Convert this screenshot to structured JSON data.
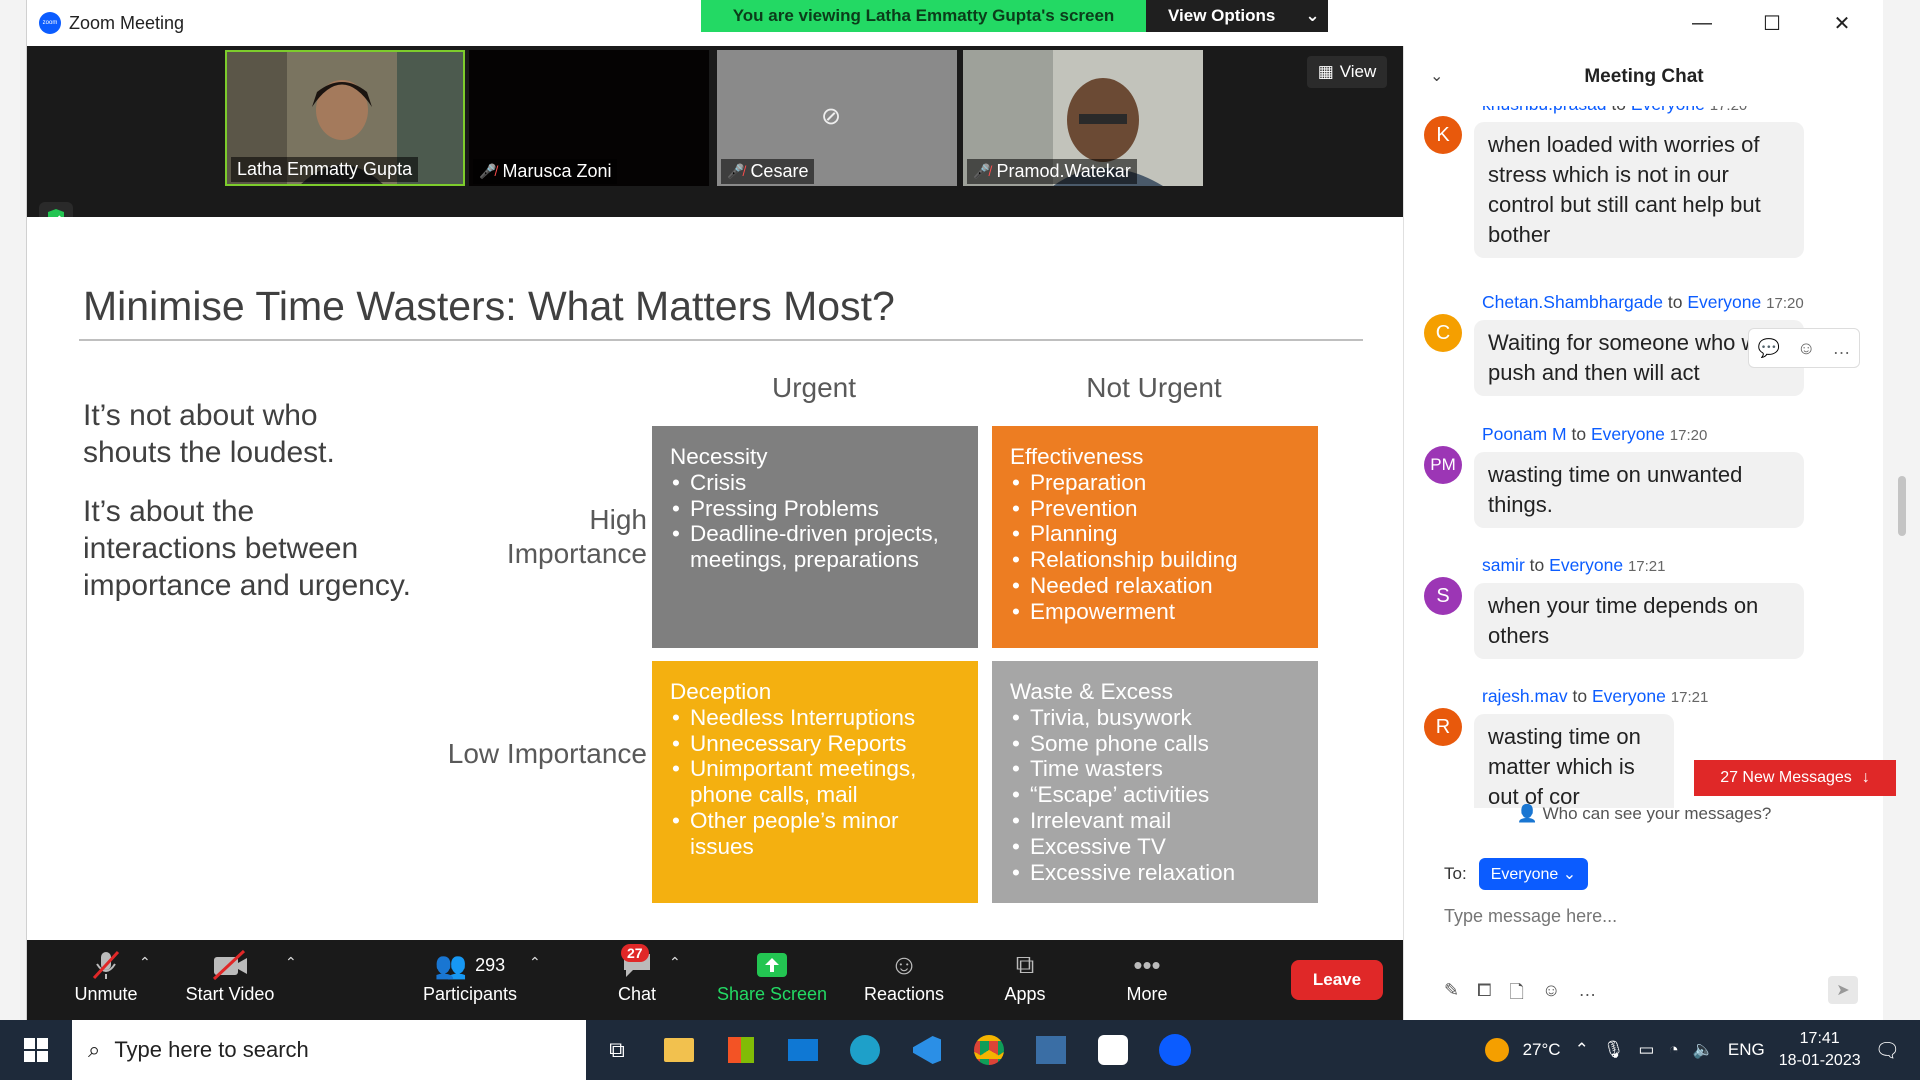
{
  "window": {
    "app_title": "Zoom Meeting",
    "viewing_banner": "You are viewing Latha Emmatty Gupta's screen",
    "view_options_label": "View Options"
  },
  "video_strip": {
    "participants": [
      {
        "name": "Latha Emmatty Gupta",
        "muted": false,
        "active": true
      },
      {
        "name": "Marusca Zoni",
        "muted": true
      },
      {
        "name": "Cesare",
        "muted": true
      },
      {
        "name": "Pramod.Watekar",
        "muted": true
      }
    ],
    "view_label": "View"
  },
  "slide": {
    "title": "Minimise Time Wasters: What Matters Most?",
    "left_text_1": "It’s not about who shouts the loudest.",
    "left_text_2": "It’s about the interactions between importance and urgency.",
    "col_urgent": "Urgent",
    "col_not_urgent": "Not Urgent",
    "row_high": "High Importance",
    "row_low": "Low Importance",
    "quadrants": {
      "necessity": {
        "title": "Necessity",
        "items": [
          "Crisis",
          "Pressing Problems",
          "Deadline-driven projects, meetings, preparations"
        ],
        "color": "#7f7f7f"
      },
      "effectiveness": {
        "title": "Effectiveness",
        "items": [
          "Preparation",
          "Prevention",
          "Planning",
          "Relationship building",
          "Needed relaxation",
          "Empowerment"
        ],
        "color": "#ed7d22"
      },
      "deception": {
        "title": "Deception",
        "items": [
          "Needless Interruptions",
          "Unnecessary Reports",
          "Unimportant meetings, phone calls, mail",
          "Other people’s minor issues"
        ],
        "color": "#f4b010"
      },
      "waste": {
        "title": "Waste & Excess",
        "items": [
          "Trivia, busywork",
          "Some phone calls",
          "Time wasters",
          "“Escape’ activities",
          "Irrelevant mail",
          "Excessive TV",
          "Excessive relaxation"
        ],
        "color": "#a6a6a6"
      }
    }
  },
  "toolbar": {
    "unmute": "Unmute",
    "start_video": "Start Video",
    "participants": "Participants",
    "participants_count": "293",
    "chat": "Chat",
    "chat_badge": "27",
    "share_screen": "Share Screen",
    "reactions": "Reactions",
    "apps": "Apps",
    "more": "More",
    "leave": "Leave"
  },
  "chat": {
    "title": "Meeting Chat",
    "messages": [
      {
        "initial": "K",
        "sender": "khushbu.prasad",
        "to": "to",
        "recipient": "Everyone",
        "time": "17:20",
        "text": "when loaded with worries of stress which is not in our control but still cant help but bother",
        "avatar_color": "#e8590c"
      },
      {
        "initial": "C",
        "sender": "Chetan.Shambhargade",
        "to": "to",
        "recipient": "Everyone",
        "time": "17:20",
        "text": "Waiting for someone who will push and then will act",
        "avatar_color": "#f59f00"
      },
      {
        "initial": "PM",
        "sender": "Poonam M",
        "to": "to",
        "recipient": "Everyone",
        "time": "17:20",
        "text": "wasting  time on unwanted things.",
        "avatar_color": "#9c36b5"
      },
      {
        "initial": "S",
        "sender": "samir",
        "to": "to",
        "recipient": "Everyone",
        "time": "17:21",
        "text": "when your time depends on others",
        "avatar_color": "#9c36b5"
      },
      {
        "initial": "R",
        "sender": "rajesh.mav",
        "to": "to",
        "recipient": "Everyone",
        "time": "17:21",
        "text": "wasting time on matter which is out of cor",
        "avatar_color": "#e8590c"
      }
    ],
    "new_messages": "27 New Messages",
    "who_can_see": "Who can see your messages?",
    "to_label": "To:",
    "to_value": "Everyone",
    "input_placeholder": "Type message here..."
  },
  "taskbar": {
    "search_placeholder": "Type here to search",
    "temperature": "27°C",
    "language": "ENG",
    "time": "17:41",
    "date": "18-01-2023"
  }
}
